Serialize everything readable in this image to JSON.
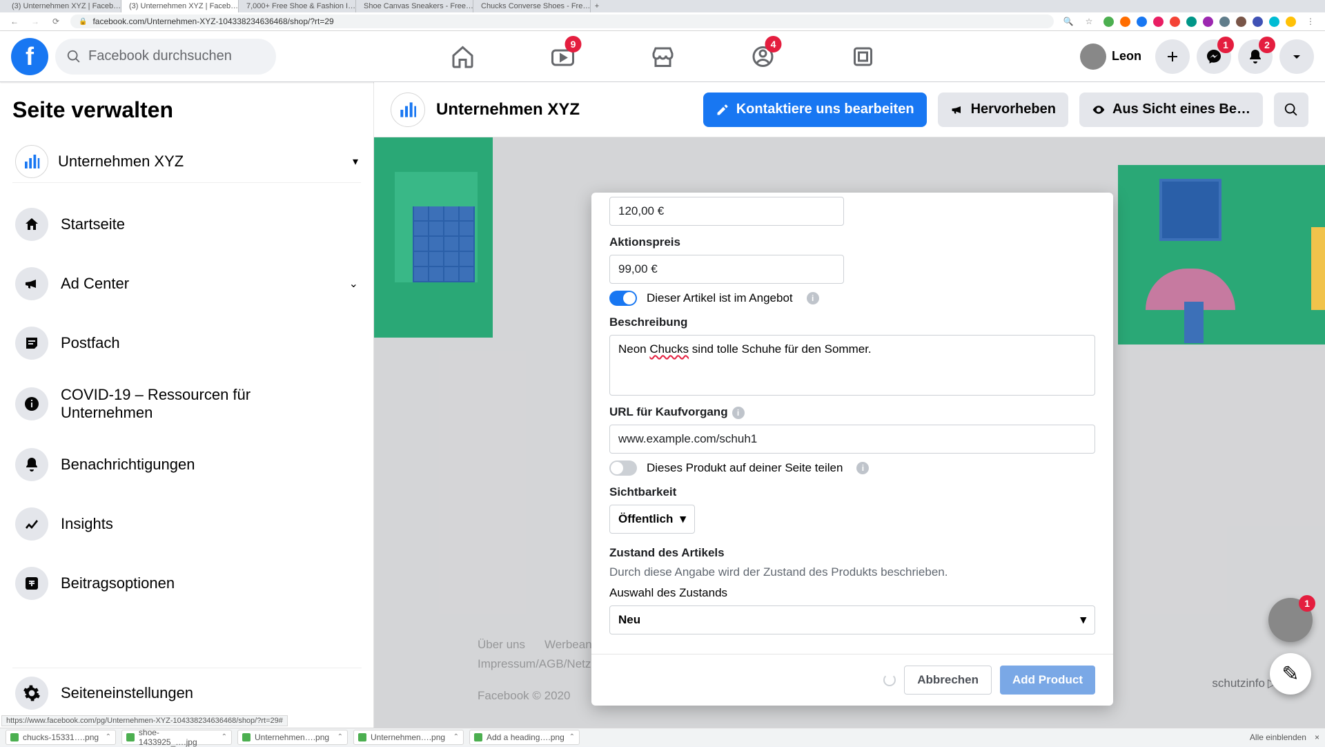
{
  "chrome": {
    "tabs": [
      {
        "title": "(3) Unternehmen XYZ | Faceb…",
        "fav": "fb",
        "active": false
      },
      {
        "title": "(3) Unternehmen XYZ | Faceb…",
        "fav": "fb",
        "active": true
      },
      {
        "title": "7,000+ Free Shoe & Fashion I…",
        "fav": "g",
        "active": false
      },
      {
        "title": "Shoe Canvas Sneakers - Free…",
        "fav": "g",
        "active": false
      },
      {
        "title": "Chucks Converse Shoes - Fre…",
        "fav": "g",
        "active": false
      }
    ],
    "url": "facebook.com/Unternehmen-XYZ-104338234636468/shop/?rt=29",
    "status_url": "https://www.facebook.com/pg/Unternehmen-XYZ-104338234636468/shop/?rt=29#",
    "show_all": "Alle einblenden",
    "downloads": [
      {
        "name": "chucks-15331….png"
      },
      {
        "name": "shoe-1433925_….jpg"
      },
      {
        "name": "Unternehmen….png"
      },
      {
        "name": "Unternehmen….png"
      },
      {
        "name": "Add a heading….png"
      }
    ]
  },
  "fb": {
    "search_placeholder": "Facebook durchsuchen",
    "badges": {
      "watch": "9",
      "groups": "4",
      "messenger": "1",
      "notifications": "2"
    },
    "profile_name": "Leon"
  },
  "sidebar": {
    "title": "Seite verwalten",
    "page_name": "Unternehmen XYZ",
    "items": [
      {
        "label": "Startseite"
      },
      {
        "label": "Ad Center"
      },
      {
        "label": "Postfach"
      },
      {
        "label": "COVID-19 – Ressourcen für Unternehmen"
      },
      {
        "label": "Benachrichtigungen"
      },
      {
        "label": "Insights"
      },
      {
        "label": "Beitragsoptionen"
      }
    ],
    "settings_label": "Seiteneinstellungen"
  },
  "pagebar": {
    "page_name": "Unternehmen XYZ",
    "contact_btn": "Kontaktiere uns bearbeiten",
    "promote_btn": "Hervorheben",
    "viewas_btn": "Aus Sicht eines Be…"
  },
  "modal": {
    "price_value": "120,00 €",
    "sale_label": "Aktionspreis",
    "sale_value": "99,00 €",
    "on_sale_text": "Dieser Artikel ist im Angebot",
    "desc_label": "Beschreibung",
    "desc_pre": "Neon ",
    "desc_spell": "Chucks",
    "desc_post": " sind tolle Schuhe für den Sommer.",
    "url_label": "URL für Kaufvorgang",
    "url_value": "www.example.com/schuh1",
    "share_text": "Dieses Produkt auf deiner Seite teilen",
    "visibility_label": "Sichtbarkeit",
    "visibility_value": "Öffentlich",
    "condition_title": "Zustand des Artikels",
    "condition_sub": "Durch diese Angabe wird der Zustand des Produkts beschrieben.",
    "condition_select_label": "Auswahl des Zustands",
    "condition_value": "Neu",
    "cancel": "Abbrechen",
    "add": "Add Product"
  },
  "footer": {
    "about": "Über uns",
    "ads": "Werbean",
    "impress": "Impressum/AGB/Netz",
    "priv": "schutzinfo",
    "copyright": "Facebook © 2020"
  },
  "chat_badge": "1"
}
